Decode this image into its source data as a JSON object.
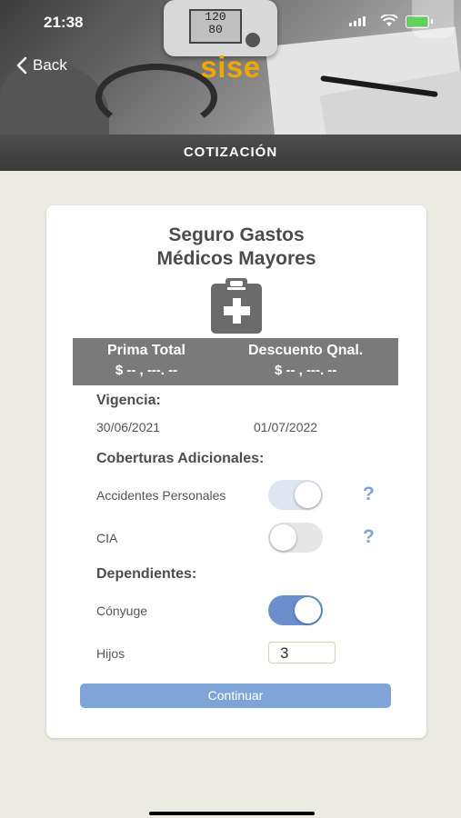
{
  "status_bar": {
    "time": "21:38"
  },
  "hero": {
    "device_reading_top": "120",
    "device_reading_bottom": "80"
  },
  "nav": {
    "back_label": "Back",
    "logo": "sise"
  },
  "header": {
    "title": "COTIZACIÓN"
  },
  "card": {
    "title_line1": "Seguro Gastos",
    "title_line2": "Médicos Mayores",
    "icon": "medical-clipboard-icon",
    "premium": {
      "prima_label": "Prima Total",
      "prima_value": "$ -- , ---. --",
      "descuento_label": "Descuento Qnal.",
      "descuento_value": "$   -- , ---. --"
    },
    "vigencia": {
      "label": "Vigencia:",
      "start": "30/06/2021",
      "end": "01/07/2022"
    },
    "coberturas": {
      "label": "Coberturas Adicionales:",
      "items": [
        {
          "label": "Accidentes Personales",
          "enabled": true,
          "disabled_state": true,
          "help": "?"
        },
        {
          "label": "CIA",
          "enabled": false,
          "help": "?"
        }
      ]
    },
    "dependientes": {
      "label": "Dependientes:",
      "conyuge_label": "Cónyuge",
      "conyuge_enabled": true,
      "hijos_label": "Hijos",
      "hijos_value": "3"
    },
    "continue_label": "Continuar"
  },
  "colors": {
    "accent": "#7ea4d8",
    "toggle_on": "#6a8fcc",
    "logo": "#f0a800"
  }
}
